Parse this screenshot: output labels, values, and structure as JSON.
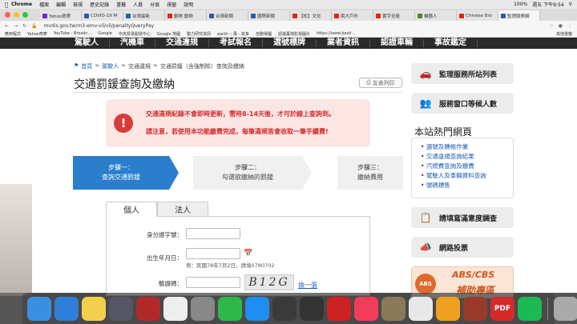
{
  "menubar": {
    "app": "Chrome",
    "items": [
      "檔案",
      "編輯",
      "檢視",
      "歷史記錄",
      "書籤",
      "人員",
      "分頁",
      "視窗",
      "說明"
    ],
    "clock": "週五 下午9:54",
    "battery": "100%"
  },
  "tabs": [
    {
      "label": "Yahoo奇摩",
      "color": "#6c2bd9"
    },
    {
      "label": "COVID-19 M",
      "color": "#2a5caa"
    },
    {
      "label": "台灣最新",
      "color": "#2a5caa"
    },
    {
      "label": "動物 動物",
      "color": "#e62117"
    },
    {
      "label": "台灣新聞",
      "color": "#2a5caa"
    },
    {
      "label": "國際新聞",
      "color": "#2a5caa"
    },
    {
      "label": "【松】文化",
      "color": "#e62117"
    },
    {
      "label": "兩大戶外",
      "color": "#e62117"
    },
    {
      "label": "實字全股",
      "color": "#e62117"
    },
    {
      "label": "機器人",
      "color": "#4a8a2a"
    },
    {
      "label": "Chinese Bro",
      "color": "#e62117"
    },
    {
      "label": "監理服務網",
      "color": "#2a5caa"
    }
  ],
  "address": {
    "url": "mvdis.gov.tw/m3-emv-vil/vil/penaltyQueryPay"
  },
  "bookmarks": [
    "應用程式",
    "Yahoo奇摩",
    "YouTube - Broadc...",
    "Google",
    "中央貿易開發中心",
    "Google 地圖",
    "動力研究資訊",
    "earth :: 風 - 氣象",
    "自動電腦",
    "認識臺灣影視圖片",
    "https://www.basti..."
  ],
  "bookmarks_other": "其他書籤",
  "sitenav": [
    "駕駛人",
    "汽機車",
    "交通違規",
    "考試報名",
    "選號標牌",
    "業者資訊",
    "認證車輛",
    "事故鑑定"
  ],
  "breadcrumb": {
    "home": "首頁",
    "items": [
      "駕駛人",
      "交通違規",
      "交通罰鍰（含強制險）查詢及繳納"
    ]
  },
  "page_title": "交通罰鍰查詢及繳納",
  "print_label": "友善列印",
  "alert": {
    "line1": "交通違規紀錄不會即時更新，需待8-14天後，才可於線上查詢到。",
    "line2": "請注意，若使用本功能繳費完成，每筆違規皆會收取一筆手續費!"
  },
  "steps": [
    {
      "title": "步驟一：",
      "desc": "查詢交通罰鍰"
    },
    {
      "title": "步驟二：",
      "desc": "勾選欲繳納的罰鍰"
    },
    {
      "title": "步驟三：",
      "desc": "繳納費用"
    }
  ],
  "form_tabs": [
    "個人",
    "法人"
  ],
  "form": {
    "id_label": "身分證字號：",
    "birth_label": "出生年月日：",
    "birth_hint": "例：民國78年7月2日，請填0780702",
    "captcha_label": "驗證碼：",
    "captcha_text": "B12G",
    "refresh_label": "換一張"
  },
  "sidebar": {
    "btn1": "監理服務所站列表",
    "btn2": "服務窗口等候人數",
    "hot_title": "本站熱門網頁",
    "hot_links": [
      "選號及轉帳作業",
      "交通違規查詢結果",
      "汽燃費查詢及繳費",
      "駕駛人及車輛資料查詢",
      "號碼標售"
    ],
    "btn3": "請填寫滿意度調查",
    "btn4": "網路投票",
    "abs_logo": "ABS",
    "abs_line1": "ABS/CBS",
    "abs_line2": "補助專區"
  },
  "dock": [
    {
      "name": "finder",
      "color": "#3b8fe0"
    },
    {
      "name": "safari",
      "color": "#2f7fd8"
    },
    {
      "name": "notes",
      "color": "#f2d04b"
    },
    {
      "name": "launchpad",
      "color": "#556"
    },
    {
      "name": "photo-booth",
      "color": "#b02a2a"
    },
    {
      "name": "calendar",
      "color": "#eee"
    },
    {
      "name": "system-prefs",
      "color": "#888"
    },
    {
      "name": "facetime",
      "color": "#2fb84a"
    },
    {
      "name": "app-store",
      "color": "#1f8ef0"
    },
    {
      "name": "activity",
      "color": "#3a3a3a"
    },
    {
      "name": "final-cut",
      "color": "#333"
    },
    {
      "name": "photo-app",
      "color": "#c22"
    },
    {
      "name": "music",
      "color": "#f23d5a"
    },
    {
      "name": "preview",
      "color": "#8a7a5a"
    },
    {
      "name": "chrome",
      "color": "#e8e8e8"
    },
    {
      "name": "photos",
      "color": "#f0a020"
    },
    {
      "name": "downloads",
      "color": "#9a3a2a"
    },
    {
      "name": "pdf-app",
      "color": "#d42a2a"
    },
    {
      "name": "spotify",
      "color": "#1db954"
    },
    {
      "name": "trash",
      "color": "#aaa"
    }
  ],
  "dock_pdf_label": "PDF"
}
